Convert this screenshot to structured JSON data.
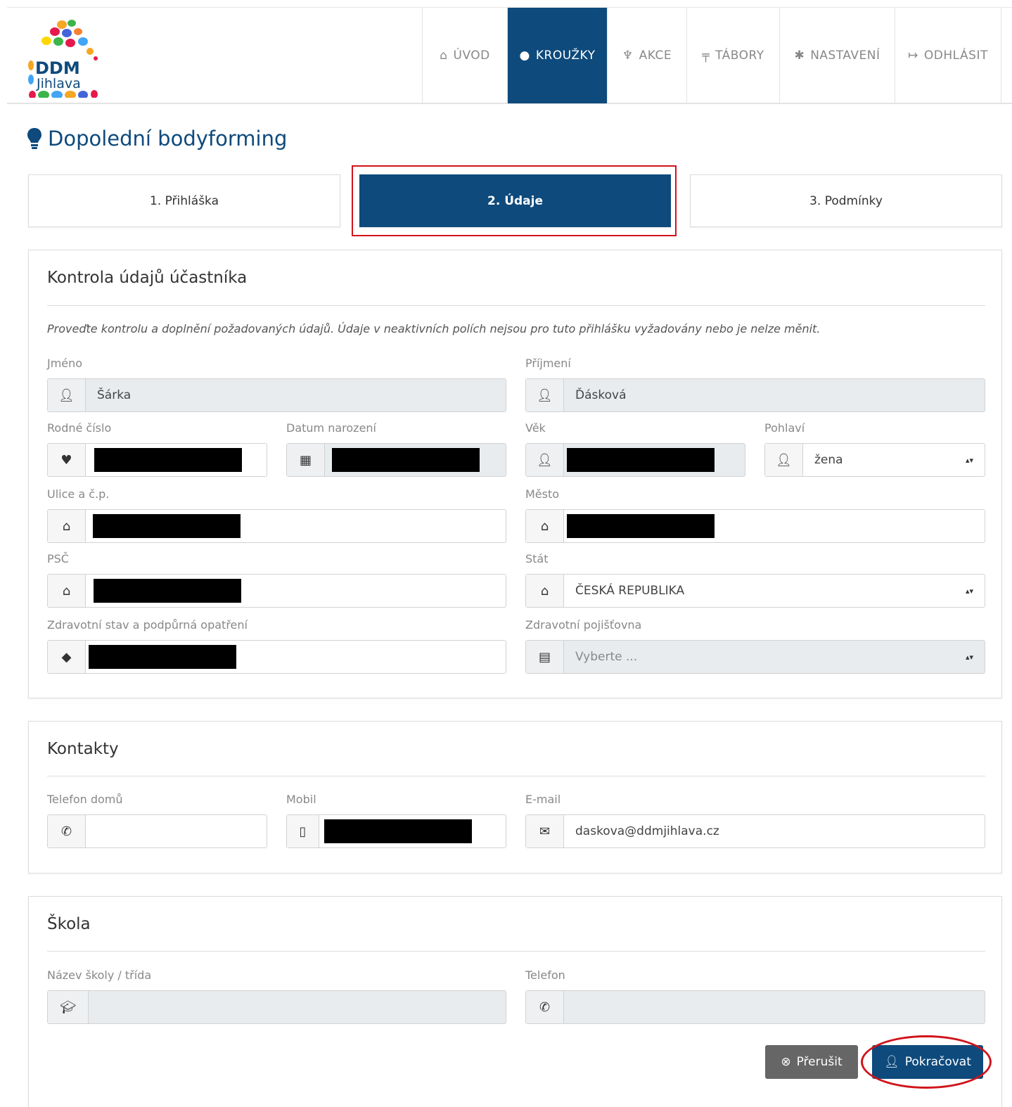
{
  "logo": {
    "line1": "DDM",
    "line2": "Jihlava"
  },
  "nav": [
    {
      "icon": "home-icon",
      "label": "ÚVOD",
      "active": false
    },
    {
      "icon": "bulb-icon",
      "label": "KROUŽKY",
      "active": true
    },
    {
      "icon": "trophy-icon",
      "label": "AKCE",
      "active": false
    },
    {
      "icon": "signpost-icon",
      "label": "TÁBORY",
      "active": false
    },
    {
      "icon": "gear-icon",
      "label": "NASTAVENÍ",
      "active": false
    },
    {
      "icon": "logout-icon",
      "label": "ODHLÁSIT",
      "active": false
    }
  ],
  "page_title": "Dopolední bodyforming",
  "steps": [
    {
      "label": "1. Přihláška",
      "active": false
    },
    {
      "label": "2. Údaje",
      "active": true
    },
    {
      "label": "3. Podmínky",
      "active": false
    }
  ],
  "participant": {
    "title": "Kontrola údajů účastníka",
    "note": "Proveďte kontrolu a doplnění požadovaných údajů. Údaje v neaktivních polích nejsou pro tuto přihlášku vyžadovány nebo je nelze měnit.",
    "first_name": {
      "label": "Jméno",
      "value": "Šárka"
    },
    "last_name": {
      "label": "Příjmení",
      "value": "Ďásková"
    },
    "birth_number": {
      "label": "Rodné číslo"
    },
    "birth_date": {
      "label": "Datum narození"
    },
    "age": {
      "label": "Věk"
    },
    "gender": {
      "label": "Pohlaví",
      "value": "žena"
    },
    "street": {
      "label": "Ulice a č.p."
    },
    "city": {
      "label": "Město"
    },
    "zip": {
      "label": "PSČ"
    },
    "country": {
      "label": "Stát",
      "value": "ČESKÁ REPUBLIKA"
    },
    "health": {
      "label": "Zdravotní stav a podpůrná opatření"
    },
    "insurance": {
      "label": "Zdravotní pojišťovna",
      "value": "Vyberte ..."
    }
  },
  "contacts": {
    "title": "Kontakty",
    "home_phone": {
      "label": "Telefon domů",
      "value": ""
    },
    "mobile": {
      "label": "Mobil"
    },
    "email": {
      "label": "E-mail",
      "value": "daskova@ddmjihlava.cz"
    }
  },
  "school": {
    "title": "Škola",
    "name": {
      "label": "Název školy / třída",
      "value": ""
    },
    "phone": {
      "label": "Telefon",
      "value": ""
    }
  },
  "buttons": {
    "cancel": "Přerušit",
    "continue": "Pokračovat"
  },
  "colors": {
    "primary": "#0e4a7c",
    "highlight": "#d0141c",
    "cancel": "#666666"
  }
}
